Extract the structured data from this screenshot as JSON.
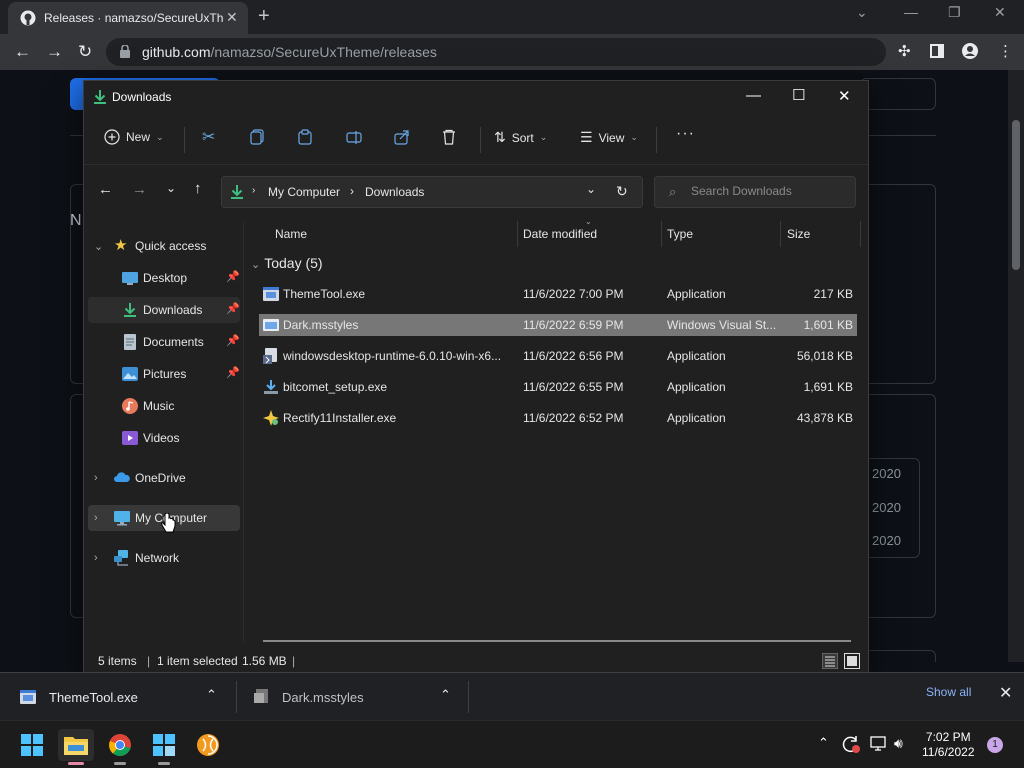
{
  "browser": {
    "tab_title": "Releases · namazso/SecureUxTheme",
    "url_host": "github.com",
    "url_path": "/namazso/SecureUxTheme/releases"
  },
  "github_page": {
    "dates": [
      "2020",
      "2020",
      "2020"
    ]
  },
  "explorer": {
    "window_title": "Downloads",
    "commands": {
      "new": "New",
      "sort": "Sort",
      "view": "View"
    },
    "breadcrumb": [
      "My Computer",
      "Downloads"
    ],
    "search_placeholder": "Search Downloads",
    "nav": {
      "quick_access": "Quick access",
      "items": [
        {
          "label": "Desktop",
          "pinned": true
        },
        {
          "label": "Downloads",
          "pinned": true
        },
        {
          "label": "Documents",
          "pinned": true
        },
        {
          "label": "Pictures",
          "pinned": true
        },
        {
          "label": "Music",
          "pinned": false
        },
        {
          "label": "Videos",
          "pinned": false
        }
      ],
      "onedrive": "OneDrive",
      "my_computer": "My Computer",
      "network": "Network"
    },
    "columns": {
      "name": "Name",
      "date": "Date modified",
      "type": "Type",
      "size": "Size"
    },
    "group": "Today (5)",
    "files": [
      {
        "name": "ThemeTool.exe",
        "date": "11/6/2022 7:00 PM",
        "type": "Application",
        "size": "217 KB"
      },
      {
        "name": "Dark.msstyles",
        "date": "11/6/2022 6:59 PM",
        "type": "Windows Visual St...",
        "size": "1,601 KB"
      },
      {
        "name": "windowsdesktop-runtime-6.0.10-win-x6...",
        "date": "11/6/2022 6:56 PM",
        "type": "Application",
        "size": "56,018 KB"
      },
      {
        "name": "bitcomet_setup.exe",
        "date": "11/6/2022 6:55 PM",
        "type": "Application",
        "size": "1,691 KB"
      },
      {
        "name": "Rectify11Installer.exe",
        "date": "11/6/2022 6:52 PM",
        "type": "Application",
        "size": "43,878 KB"
      }
    ],
    "status": {
      "count": "5 items",
      "selected": "1 item selected",
      "size": "1.56 MB"
    }
  },
  "downloads_bar": {
    "items": [
      "ThemeTool.exe",
      "Dark.msstyles"
    ],
    "show_all": "Show all"
  },
  "taskbar": {
    "time": "7:02 PM",
    "date": "11/6/2022",
    "notifications": "1"
  },
  "colors": {
    "selection": "#777777",
    "accent_link": "#8ab4f8",
    "explorer_bg": "#202020"
  }
}
